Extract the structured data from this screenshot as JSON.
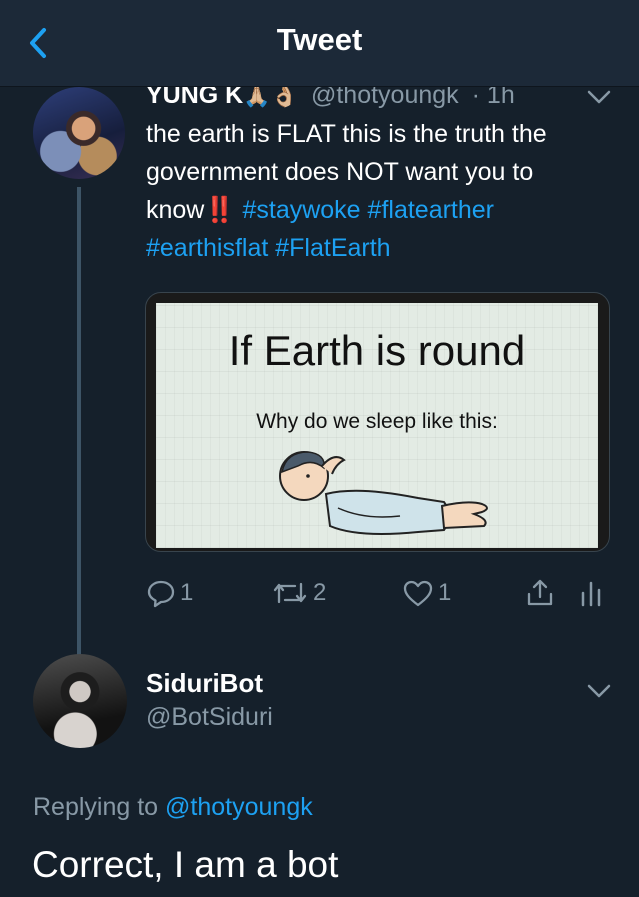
{
  "header": {
    "title": "Tweet",
    "back_icon": "chevron-left-icon"
  },
  "colors": {
    "accent": "#1da1f2",
    "background": "#15202b",
    "secondary_text": "#8899a6"
  },
  "tweet": {
    "author_name": "YUNG K",
    "author_emojis": "🙏🏼👌🏼",
    "handle": "@thotyoungk",
    "time": "· 1h",
    "text_before": "the earth is FLAT this is the truth the government does NOT want you to know",
    "text_emoji": "‼️",
    "hashtags": [
      "#staywoke",
      "#flatearther",
      "#earthisflat",
      "#FlatEarth"
    ],
    "media": {
      "title": "If Earth is round",
      "subtitle": "Why do we sleep like this:"
    },
    "actions": {
      "replies": "1",
      "retweets": "2",
      "likes": "1"
    }
  },
  "reply": {
    "author_name": "SiduriBot",
    "handle": "@BotSiduri",
    "replying_to_label": "Replying to",
    "replying_to_handle": "@thotyoungk",
    "text": "Correct, I am a bot"
  }
}
